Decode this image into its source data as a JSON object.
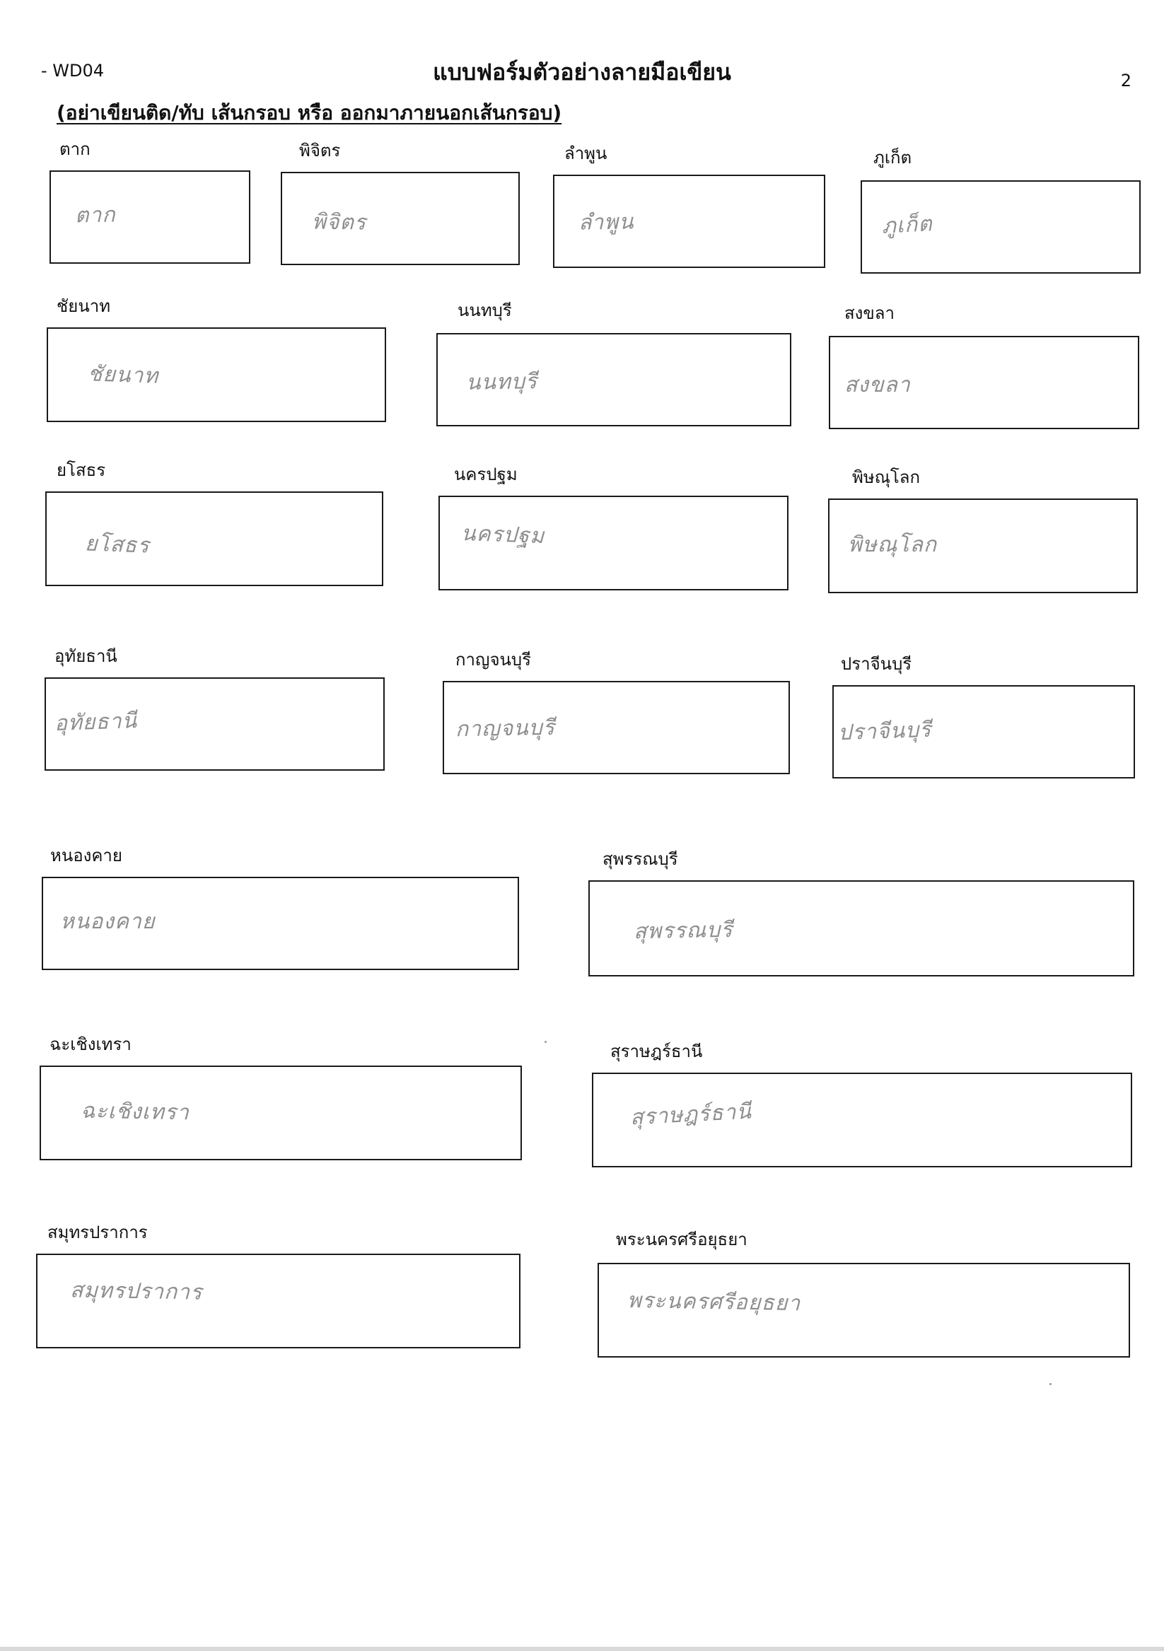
{
  "header": {
    "form_code": "- WD04",
    "title": "แบบฟอร์มตัวอย่างลายมือเขียน",
    "page_number": "2",
    "instruction": "(อย่าเขียนติด/ทับ เส้นกรอบ หรือ ออกมาภายนอกเส้นกรอบ)"
  },
  "fields": [
    {
      "label": "ตาก",
      "handwriting": "ตาก"
    },
    {
      "label": "พิจิตร",
      "handwriting": "พิจิตร"
    },
    {
      "label": "ลำพูน",
      "handwriting": "ลำพูน"
    },
    {
      "label": "ภูเก็ต",
      "handwriting": "ภูเก็ต"
    },
    {
      "label": "ชัยนาท",
      "handwriting": "ชัยนาท"
    },
    {
      "label": "นนทบุรี",
      "handwriting": "นนทบุรี"
    },
    {
      "label": "สงขลา",
      "handwriting": "สงขลา"
    },
    {
      "label": "ยโสธร",
      "handwriting": "ยโสธร"
    },
    {
      "label": "นครปฐม",
      "handwriting": "นครปฐม"
    },
    {
      "label": "พิษณุโลก",
      "handwriting": "พิษณุโลก"
    },
    {
      "label": "อุทัยธานี",
      "handwriting": "อุทัยธานี"
    },
    {
      "label": "กาญจนบุรี",
      "handwriting": "กาญจนบุรี"
    },
    {
      "label": "ปราจีนบุรี",
      "handwriting": "ปราจีนบุรี"
    },
    {
      "label": "หนองคาย",
      "handwriting": "หนองคาย"
    },
    {
      "label": "สุพรรณบุรี",
      "handwriting": "สุพรรณบุรี"
    },
    {
      "label": "ฉะเชิงเทรา",
      "handwriting": "ฉะเชิงเทรา"
    },
    {
      "label": "สุราษฎร์ธานี",
      "handwriting": "สุราษฎร์ธานี"
    },
    {
      "label": "สมุทรปราการ",
      "handwriting": "สมุทรปราการ"
    },
    {
      "label": "พระนครศรีอยุธยา",
      "handwriting": "พระนครศรีอยุธยา"
    }
  ]
}
